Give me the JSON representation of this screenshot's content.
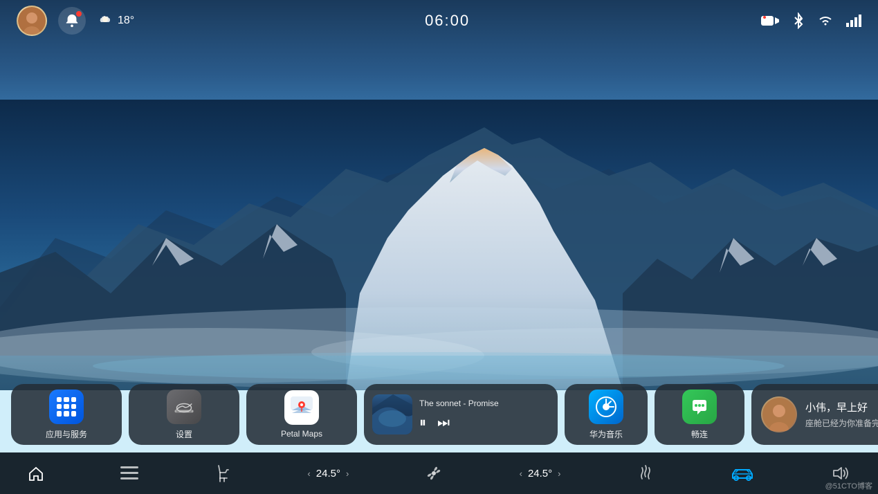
{
  "statusBar": {
    "time": "06:00",
    "weather": "18°",
    "weatherIcon": "cloud-sun-icon"
  },
  "dock": {
    "apps": [
      {
        "id": "app-services",
        "label": "应用与服务",
        "icon": "grid-icon"
      },
      {
        "id": "settings",
        "label": "设置",
        "icon": "car-icon"
      },
      {
        "id": "petal-maps",
        "label": "Petal Maps",
        "icon": "maps-icon"
      }
    ],
    "musicPlayer": {
      "title": "The sonnet - Promise",
      "icon": "pause-icon",
      "nextIcon": "next-icon"
    },
    "huaweiMusic": {
      "label": "华为音乐",
      "icon": "music-note-icon"
    },
    "畅连": {
      "label": "畅连",
      "icon": "message-icon"
    },
    "greeting": {
      "name": "小伟，早上好",
      "subtitle": "座舱已经为你准备完毕"
    }
  },
  "controlBar": {
    "homeLabel": "home",
    "gridLabel": "grid",
    "seatLabel": "seat",
    "tempLeft": "24.5°",
    "fanLabel": "fan",
    "tempRight": "24.5°",
    "legLabel": "leg",
    "carLabel": "car",
    "volumeLabel": "volume"
  },
  "watermark": "@51CTO博客"
}
